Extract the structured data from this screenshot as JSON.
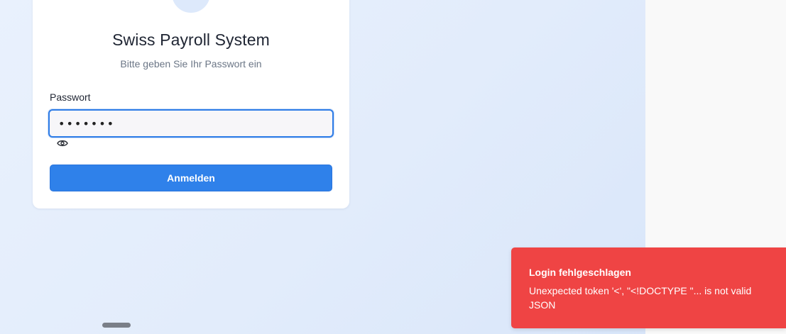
{
  "login": {
    "title": "Swiss Payroll System",
    "subtitle": "Bitte geben Sie Ihr Passwort ein",
    "password_label": "Passwort",
    "password_value": "•••••••",
    "submit_label": "Anmelden",
    "logo_icon": "lock-icon",
    "toggle_icon": "eye-icon"
  },
  "toast": {
    "title": "Login fehlgeschlagen",
    "message": "Unexpected token '<', \"<!DOCTYPE \"... is not valid JSON"
  },
  "colors": {
    "accent": "#2f81ea",
    "error": "#ef4444",
    "background": "#e6effc"
  }
}
